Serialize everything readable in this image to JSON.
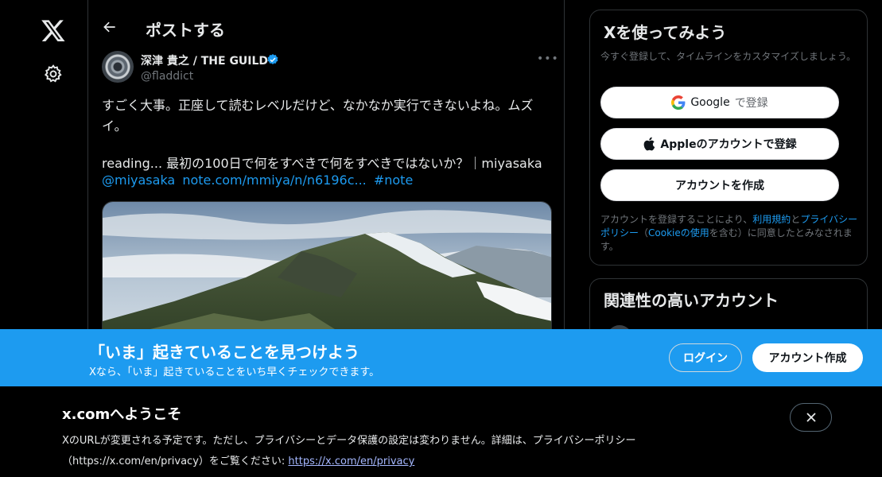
{
  "nav": {
    "logo_icon": "x-logo-icon",
    "settings_icon": "gear-icon"
  },
  "post": {
    "header_title": "ポストする",
    "author": {
      "name": "深津 貴之 / THE GUILD",
      "handle": "@fladdict",
      "verified": true
    },
    "text_line1": "すごく大事。正座して読むレベルだけど、なかなか実行できないよね。ムズイ。",
    "text_line2": "reading... 最初の100日で何をすべきで何をすべきではないか？｜miyasaka",
    "mention": "@miyasaka",
    "link": "note.com/mmiya/n/n6196c...",
    "hashtag": "#note"
  },
  "signup": {
    "title": "Xを使ってみよう",
    "subtitle": "今すぐ登録して、タイムラインをカスタマイズしましょう。",
    "google_brand": "Google",
    "google_action": "で登録",
    "apple_label": "Appleのアカウントで登録",
    "create_label": "アカウントを作成",
    "terms_prefix": "アカウントを登録することにより、",
    "terms_link": "利用規約",
    "terms_and": "と",
    "privacy_link": "プライバシーポリシー",
    "terms_paren_open": "（",
    "cookie_link": "Cookieの使用",
    "terms_paren_close": "を含む）に同意したとみなされます。"
  },
  "related": {
    "title": "関連性の高いアカウント"
  },
  "banner": {
    "title": "「いま」起きていることを見つけよう",
    "subtitle": "Xなら、「いま」起きていることをいち早くチェックできます。",
    "login_label": "ログイン",
    "signup_label": "アカウント作成"
  },
  "notice": {
    "title": "x.comへようこそ",
    "body": "XのURLが変更される予定です。ただし、プライバシーとデータ保護の設定は変わりません。詳細は、プライバシーポリシー（https://x.com/en/privacy）をご覧ください: ",
    "link": "https://x.com/en/privacy"
  }
}
